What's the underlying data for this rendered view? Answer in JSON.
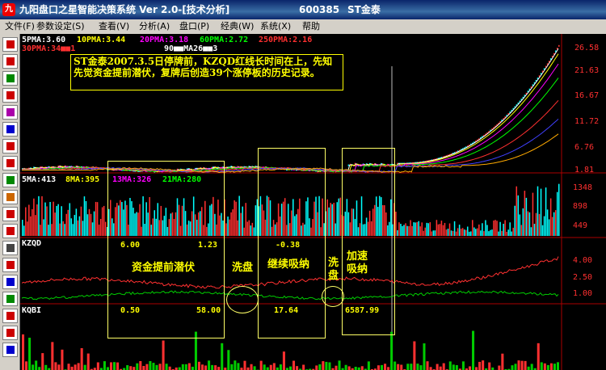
{
  "titlebar": {
    "app_icon": "九",
    "title": "九阳盘口之星智能决策系统 Ver 2.0-[技术分析]",
    "code": "600385",
    "name": "ST金泰"
  },
  "menu": [
    "文件(F)",
    "参数设定(S)",
    "查看(V)",
    "分析(A)",
    "盘口(P)",
    "经典(W)",
    "系统(X)",
    "帮助"
  ],
  "price_panel": {
    "ma_labels": [
      {
        "text": "5PMA:3.60",
        "color": "#ffffff"
      },
      {
        "text": "10PMA:3.44",
        "color": "#ffff00"
      },
      {
        "text": "20PMA:3.18",
        "color": "#ff00ff"
      },
      {
        "text": "60PMA:2.72",
        "color": "#00ff00"
      },
      {
        "text": "250PMA:2.16",
        "color": "#ff3030"
      }
    ],
    "ma_labels_2": [
      {
        "text": "30PMA:34■■1",
        "color": "#ff3030"
      },
      {
        "text": "90■■MA26■■3",
        "color": "#ffffff"
      }
    ],
    "axis": [
      "26.58",
      "21.63",
      "16.67",
      "11.72",
      "6.76",
      "1.81"
    ],
    "annotation": "ST金泰2007.3.5日停牌前，KZQD红线长时间在上，先知先觉资金提前潜伏，复牌后创造39个涨停板的历史记录。"
  },
  "volume_panel": {
    "labels": [
      {
        "text": "5MA:413",
        "color": "#ffffff"
      },
      {
        "text": "8MA:395",
        "color": "#ffff00"
      },
      {
        "text": "13MA:326",
        "color": "#ff00ff"
      },
      {
        "text": "21MA:280",
        "color": "#00ff00"
      }
    ],
    "axis": [
      "1348",
      "898",
      "449"
    ]
  },
  "kzqd_panel": {
    "label": "KZQD",
    "values": [
      "6.00",
      "1.23",
      "-0.38"
    ],
    "axis": [
      "4.00",
      "2.50",
      "1.00"
    ],
    "phases": [
      "资金提前潜伏",
      "洗盘",
      "继续吸纳",
      "洗盘",
      "加速吸纳"
    ]
  },
  "kqbi_panel": {
    "label": "KQBI",
    "values": [
      "0.50",
      "58.00",
      "17.64",
      "6587.99"
    ]
  },
  "colors": {
    "up": "#ff3030",
    "down": "#00ffff",
    "annotation": "#ffff00",
    "kzqd_red": "#ff3030",
    "kzqd_green": "#00cc00"
  }
}
